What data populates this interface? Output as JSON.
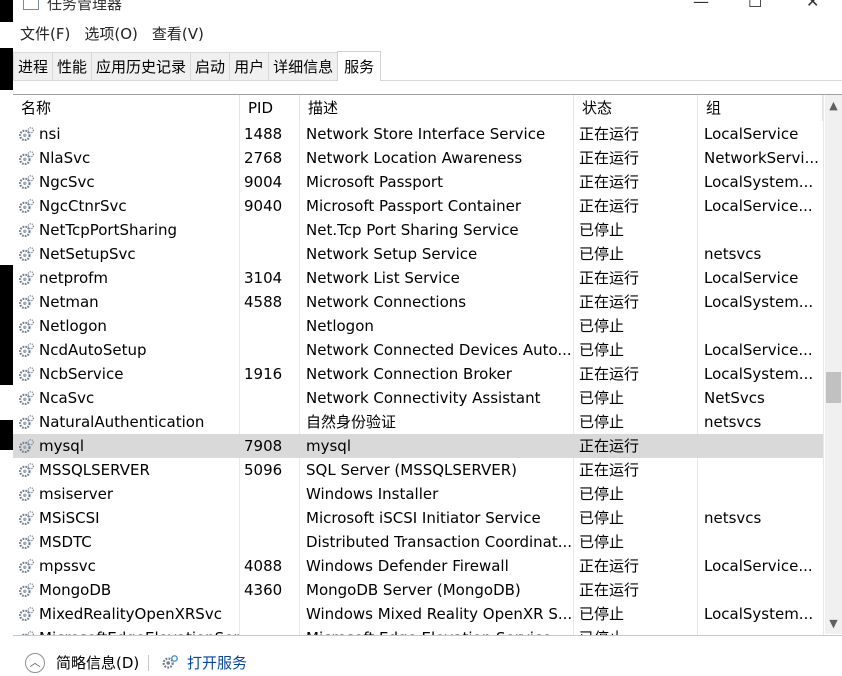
{
  "window": {
    "title": "任务管理器",
    "controls": {
      "minimize": "—",
      "maximize": "☐",
      "close": "✕"
    }
  },
  "menu": [
    "文件(F)",
    "选项(O)",
    "查看(V)"
  ],
  "tabs": [
    "进程",
    "性能",
    "应用历史记录",
    "启动",
    "用户",
    "详细信息",
    "服务"
  ],
  "active_tab": "服务",
  "columns": {
    "name": "名称",
    "pid": "PID",
    "desc": "描述",
    "status": "状态",
    "group": "组"
  },
  "rows": [
    {
      "name": "nsi",
      "pid": "1488",
      "desc": "Network Store Interface Service",
      "status": "正在运行",
      "group": "LocalService"
    },
    {
      "name": "NlaSvc",
      "pid": "2768",
      "desc": "Network Location Awareness",
      "status": "正在运行",
      "group": "NetworkServi..."
    },
    {
      "name": "NgcSvc",
      "pid": "9004",
      "desc": "Microsoft Passport",
      "status": "正在运行",
      "group": "LocalSystem..."
    },
    {
      "name": "NgcCtnrSvc",
      "pid": "9040",
      "desc": "Microsoft Passport Container",
      "status": "正在运行",
      "group": "LocalService..."
    },
    {
      "name": "NetTcpPortSharing",
      "pid": "",
      "desc": "Net.Tcp Port Sharing Service",
      "status": "已停止",
      "group": ""
    },
    {
      "name": "NetSetupSvc",
      "pid": "",
      "desc": "Network Setup Service",
      "status": "已停止",
      "group": "netsvcs"
    },
    {
      "name": "netprofm",
      "pid": "3104",
      "desc": "Network List Service",
      "status": "正在运行",
      "group": "LocalService"
    },
    {
      "name": "Netman",
      "pid": "4588",
      "desc": "Network Connections",
      "status": "正在运行",
      "group": "LocalSystem..."
    },
    {
      "name": "Netlogon",
      "pid": "",
      "desc": "Netlogon",
      "status": "已停止",
      "group": ""
    },
    {
      "name": "NcdAutoSetup",
      "pid": "",
      "desc": "Network Connected Devices Auto...",
      "status": "已停止",
      "group": "LocalService..."
    },
    {
      "name": "NcbService",
      "pid": "1916",
      "desc": "Network Connection Broker",
      "status": "正在运行",
      "group": "LocalSystem..."
    },
    {
      "name": "NcaSvc",
      "pid": "",
      "desc": "Network Connectivity Assistant",
      "status": "已停止",
      "group": "NetSvcs"
    },
    {
      "name": "NaturalAuthentication",
      "pid": "",
      "desc": "自然身份验证",
      "status": "已停止",
      "group": "netsvcs"
    },
    {
      "name": "mysql",
      "pid": "7908",
      "desc": "mysql",
      "status": "正在运行",
      "group": "",
      "selected": true
    },
    {
      "name": "MSSQLSERVER",
      "pid": "5096",
      "desc": "SQL Server (MSSQLSERVER)",
      "status": "正在运行",
      "group": ""
    },
    {
      "name": "msiserver",
      "pid": "",
      "desc": "Windows Installer",
      "status": "已停止",
      "group": ""
    },
    {
      "name": "MSiSCSI",
      "pid": "",
      "desc": "Microsoft iSCSI Initiator Service",
      "status": "已停止",
      "group": "netsvcs"
    },
    {
      "name": "MSDTC",
      "pid": "",
      "desc": "Distributed Transaction Coordinat...",
      "status": "已停止",
      "group": ""
    },
    {
      "name": "mpssvc",
      "pid": "4088",
      "desc": "Windows Defender Firewall",
      "status": "正在运行",
      "group": "LocalService..."
    },
    {
      "name": "MongoDB",
      "pid": "4360",
      "desc": "MongoDB Server (MongoDB)",
      "status": "正在运行",
      "group": ""
    },
    {
      "name": "MixedRealityOpenXRSvc",
      "pid": "",
      "desc": "Windows Mixed Reality OpenXR S...",
      "status": "已停止",
      "group": "LocalSystem..."
    },
    {
      "name": "MicrosoftEdgeElevationService",
      "pid": "",
      "desc": "Microsoft Edge Elevation Service",
      "status": "已停止",
      "group": ""
    }
  ],
  "footer": {
    "brief_label": "简略信息(D)",
    "open_services_label": "打开服务"
  },
  "icons": {
    "service": "gears-icon",
    "collapse": "chevron-up-circle-icon"
  }
}
